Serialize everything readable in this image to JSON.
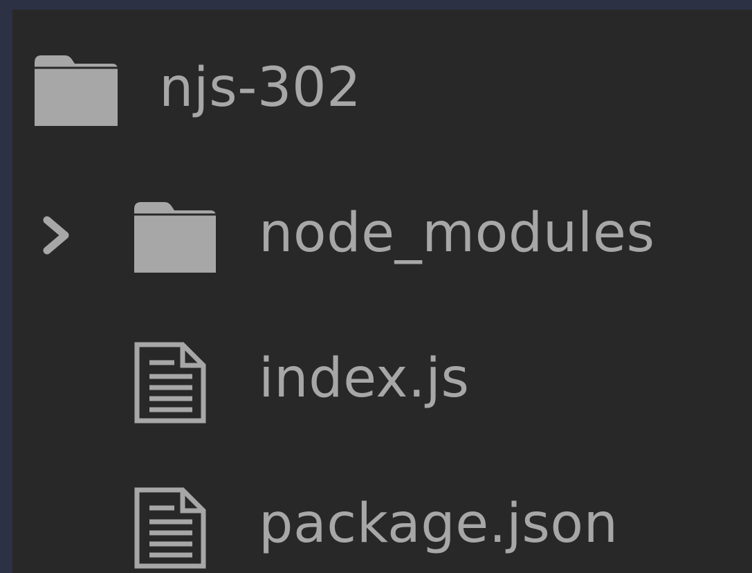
{
  "tree": {
    "root": {
      "label": "njs-302",
      "icon": "folder-icon"
    },
    "items": [
      {
        "label": "node_modules",
        "type": "folder",
        "icon": "folder-icon",
        "expanded": false,
        "chevron": "chevron-right-icon"
      },
      {
        "label": "index.js",
        "type": "file",
        "icon": "file-icon"
      },
      {
        "label": "package.json",
        "type": "file",
        "icon": "file-icon"
      }
    ]
  },
  "colors": {
    "outer_background": "#2c3144",
    "panel_background": "#282828",
    "text": "#a7a7a7",
    "icon": "#a7a7a7"
  }
}
